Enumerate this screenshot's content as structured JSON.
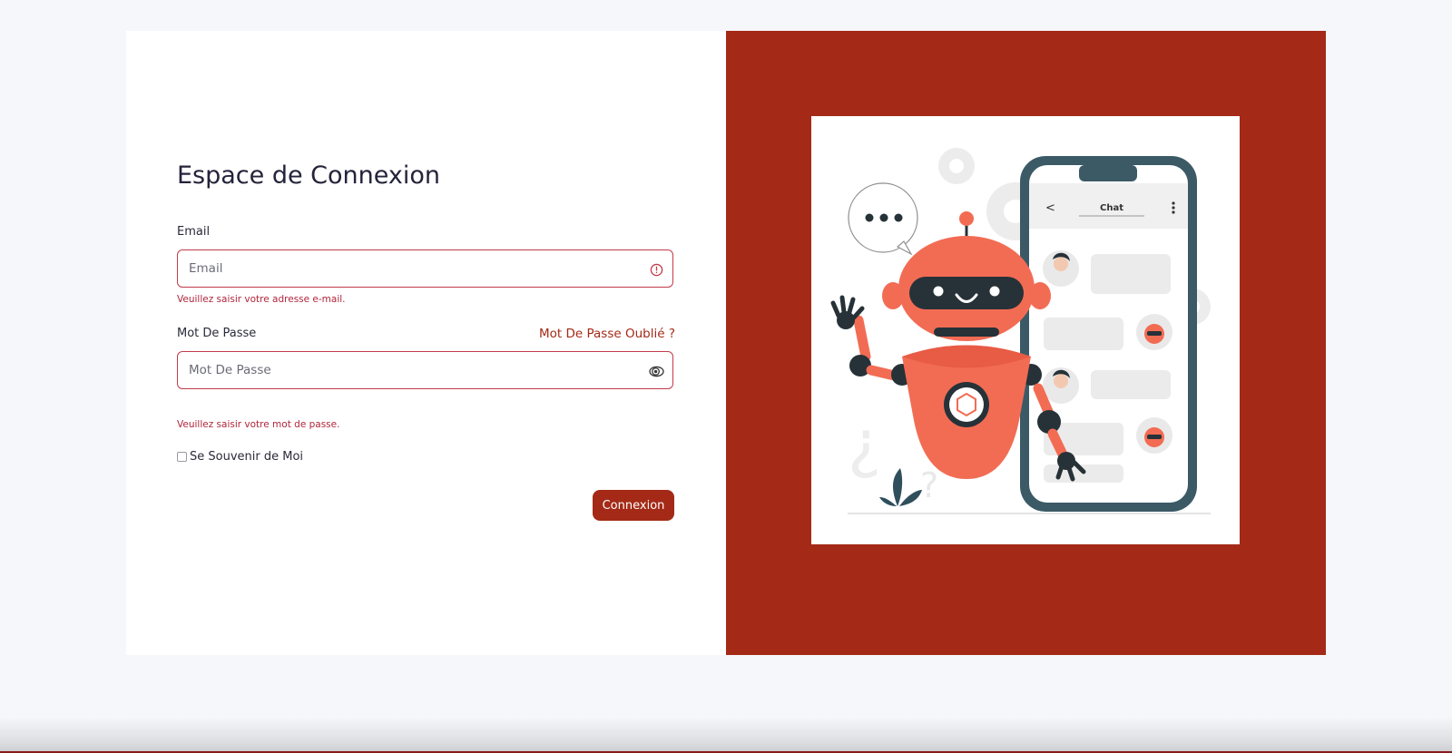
{
  "colors": {
    "accent": "#a42a17",
    "error": "#c23b4a",
    "page_background": "#f6f7fb",
    "robot": "#f26c54",
    "phone": "#3b5a66"
  },
  "login": {
    "title": "Espace de Connexion",
    "email": {
      "label": "Email",
      "placeholder": "Email",
      "value": "",
      "error": "Veuillez saisir votre adresse e-mail.",
      "icon": "alert-circle-icon"
    },
    "password": {
      "label": "Mot De Passe",
      "placeholder": "Mot De Passe",
      "value": "",
      "forgot_link": "Mot De Passe Oublié ?",
      "error": "Veuillez saisir votre mot de passe.",
      "icon": "eye-toggle-icon"
    },
    "remember": {
      "label": "Se Souvenir de Moi",
      "checked": false
    },
    "submit_label": "Connexion"
  },
  "illustration": {
    "phone_title": "Chat",
    "icons": [
      "chatbot-robot-illustration",
      "back-arrow-icon",
      "more-vertical-icon",
      "gear-icon",
      "speech-bubble-icon"
    ]
  }
}
